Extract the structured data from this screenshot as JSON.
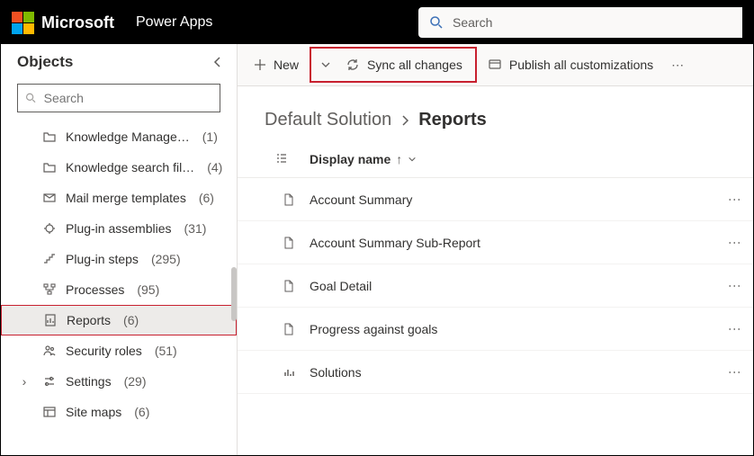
{
  "header": {
    "brand": "Microsoft",
    "app": "Power Apps",
    "search_placeholder": "Search"
  },
  "sidebar": {
    "title": "Objects",
    "search_placeholder": "Search",
    "items": [
      {
        "icon": "folder",
        "label": "Knowledge Manage…",
        "count": "(1)",
        "selected": false,
        "expandable": false
      },
      {
        "icon": "folder",
        "label": "Knowledge search fil…",
        "count": "(4)",
        "selected": false,
        "expandable": false
      },
      {
        "icon": "mail",
        "label": "Mail merge templates",
        "count": "(6)",
        "selected": false,
        "expandable": false
      },
      {
        "icon": "plugin",
        "label": "Plug-in assemblies",
        "count": "(31)",
        "selected": false,
        "expandable": false
      },
      {
        "icon": "steps",
        "label": "Plug-in steps",
        "count": "(295)",
        "selected": false,
        "expandable": false
      },
      {
        "icon": "flow",
        "label": "Processes",
        "count": "(95)",
        "selected": false,
        "expandable": false
      },
      {
        "icon": "report",
        "label": "Reports",
        "count": "(6)",
        "selected": true,
        "expandable": false
      },
      {
        "icon": "roles",
        "label": "Security roles",
        "count": "(51)",
        "selected": false,
        "expandable": false
      },
      {
        "icon": "settings",
        "label": "Settings",
        "count": "(29)",
        "selected": false,
        "expandable": true
      },
      {
        "icon": "sitemap",
        "label": "Site maps",
        "count": "(6)",
        "selected": false,
        "expandable": false
      }
    ]
  },
  "commands": {
    "new": "New",
    "sync": "Sync all changes",
    "publish": "Publish all customizations"
  },
  "breadcrumb": {
    "parent": "Default Solution",
    "current": "Reports"
  },
  "column": {
    "name": "Display name"
  },
  "rows": [
    {
      "icon": "doc",
      "name": "Account Summary"
    },
    {
      "icon": "doc",
      "name": "Account Summary Sub-Report"
    },
    {
      "icon": "doc",
      "name": "Goal Detail"
    },
    {
      "icon": "doc",
      "name": "Progress against goals"
    },
    {
      "icon": "chart",
      "name": "Solutions"
    }
  ]
}
